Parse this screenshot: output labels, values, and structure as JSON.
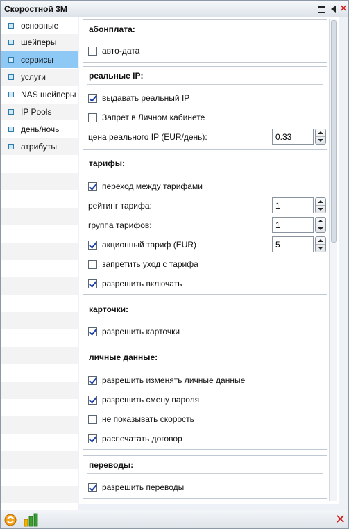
{
  "window": {
    "title": "Скоростной 3M"
  },
  "sidebar": {
    "items": [
      {
        "label": "основные"
      },
      {
        "label": "шейперы"
      },
      {
        "label": "сервисы"
      },
      {
        "label": "услуги"
      },
      {
        "label": "NAS шейперы"
      },
      {
        "label": "IP Pools"
      },
      {
        "label": "день/ночь"
      },
      {
        "label": "атрибуты"
      }
    ],
    "active_index": 2
  },
  "groups": {
    "abonplata": {
      "title": "абонплата:",
      "auto_date": {
        "label": "авто-дата",
        "checked": false
      }
    },
    "real_ip": {
      "title": "реальные IP:",
      "give_real_ip": {
        "label": "выдавать реальный IP",
        "checked": true
      },
      "ban_in_cabinet": {
        "label": "Запрет в Личном кабинете",
        "checked": false
      },
      "price": {
        "label": "цена реального IP (EUR/день):",
        "value": "0.33"
      }
    },
    "tariffs": {
      "title": "тарифы:",
      "switch_between": {
        "label": "переход между тарифами",
        "checked": true
      },
      "rating": {
        "label": "рейтинг тарифа:",
        "value": "1"
      },
      "group": {
        "label": "группа тарифов:",
        "value": "1"
      },
      "promo": {
        "label": "акционный тариф (EUR)",
        "checked": true,
        "value": "5"
      },
      "forbid_leave": {
        "label": "запретить уход с тарифа",
        "checked": false
      },
      "allow_enable": {
        "label": "разрешить включать",
        "checked": true
      }
    },
    "cards": {
      "title": "карточки:",
      "allow_cards": {
        "label": "разрешить карточки",
        "checked": true
      }
    },
    "personal": {
      "title": "личные данные:",
      "allow_change_data": {
        "label": "разрешить изменять личные данные",
        "checked": true
      },
      "allow_change_password": {
        "label": "разрешить смену пароля",
        "checked": true
      },
      "hide_speed": {
        "label": "не показывать скорость",
        "checked": false
      },
      "print_contract": {
        "label": "распечатать договор",
        "checked": true
      }
    },
    "transfers": {
      "title": "переводы:",
      "allow_transfers": {
        "label": "разрешить переводы",
        "checked": true
      }
    }
  },
  "footer": {
    "refresh_icon": "refresh-icon",
    "chart_icon": "bar-chart-icon",
    "close_icon": "close-icon"
  },
  "colors": {
    "active_item": "#8ec8f5",
    "close_red": "#d51c1c",
    "check_blue": "#1c3fa8"
  }
}
